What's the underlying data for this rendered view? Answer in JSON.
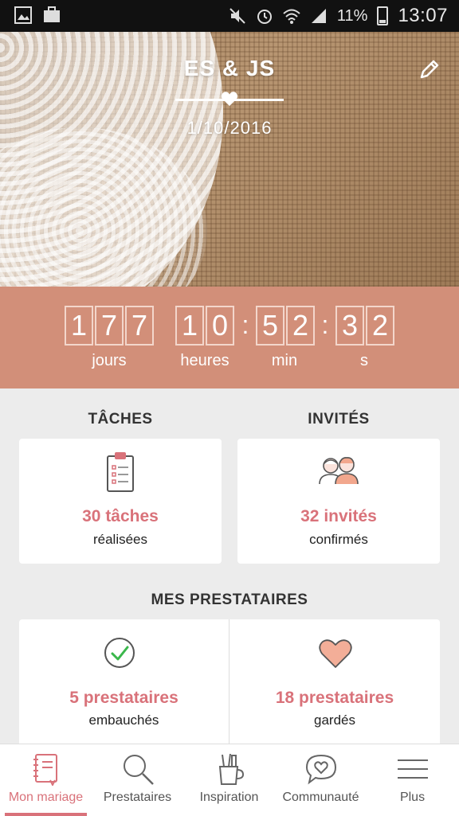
{
  "status_bar": {
    "time": "13:07",
    "battery": "11%"
  },
  "header": {
    "names": "ES & JS",
    "date": "1/10/2016"
  },
  "countdown": {
    "days_digits": [
      "1",
      "7",
      "7"
    ],
    "hours_digits": [
      "1",
      "0"
    ],
    "min_digits": [
      "5",
      "2"
    ],
    "sec_digits": [
      "3",
      "2"
    ],
    "labels": {
      "days": "jours",
      "hours": "heures",
      "min": "min",
      "sec": "s"
    }
  },
  "tasks": {
    "title": "TÂCHES",
    "value": "30 tâches",
    "sub": "réalisées"
  },
  "guests": {
    "title": "INVITÉS",
    "value": "32 invités",
    "sub": "confirmés"
  },
  "vendors": {
    "title": "MES PRESTATAIRES",
    "hired": {
      "value": "5 prestataires",
      "sub": "embauchés"
    },
    "saved": {
      "value": "18 prestataires",
      "sub": "gardés"
    }
  },
  "nav": {
    "items": [
      {
        "label": "Mon mariage",
        "icon": "notebook-icon"
      },
      {
        "label": "Prestataires",
        "icon": "search-icon"
      },
      {
        "label": "Inspiration",
        "icon": "pencil-cup-icon"
      },
      {
        "label": "Communauté",
        "icon": "chat-heart-icon"
      },
      {
        "label": "Plus",
        "icon": "menu-icon"
      }
    ]
  },
  "colors": {
    "accent": "#d9727a",
    "countdown_bg": "#d28f79"
  }
}
